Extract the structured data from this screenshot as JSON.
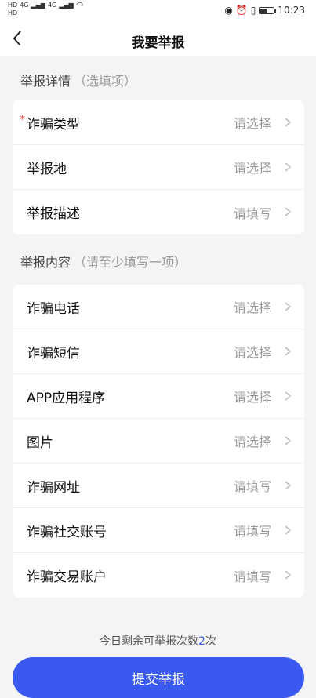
{
  "status_bar": {
    "signal_1": "HD",
    "signal_2": "HD",
    "net_1": "4G",
    "net_2": "4G",
    "time": "10:23",
    "battery_level": 0.5
  },
  "header": {
    "title": "我要举报"
  },
  "details_section": {
    "title": "举报详情",
    "hint": "（选填项）",
    "required_mark": "*",
    "items": [
      {
        "label": "诈骗类型",
        "value": "请选择"
      },
      {
        "label": "举报地",
        "value": "请选择"
      },
      {
        "label": "举报描述",
        "value": "请填写"
      }
    ]
  },
  "content_section": {
    "title": "举报内容",
    "hint": "（请至少填写一项）",
    "items": [
      {
        "label": "诈骗电话",
        "value": "请选择"
      },
      {
        "label": "诈骗短信",
        "value": "请选择"
      },
      {
        "label": "APP应用程序",
        "value": "请选择"
      },
      {
        "label": "图片",
        "value": "请选择"
      },
      {
        "label": "诈骗网址",
        "value": "请填写"
      },
      {
        "label": "诈骗社交账号",
        "value": "请填写"
      },
      {
        "label": "诈骗交易账户",
        "value": "请填写"
      }
    ]
  },
  "remaining": {
    "prefix": "今日剩余可举报次数",
    "count": "2",
    "suffix": "次"
  },
  "submit_label": "提交举报",
  "colors": {
    "accent": "#3a59ee",
    "required": "#e53935",
    "background": "#f4f4f6"
  }
}
